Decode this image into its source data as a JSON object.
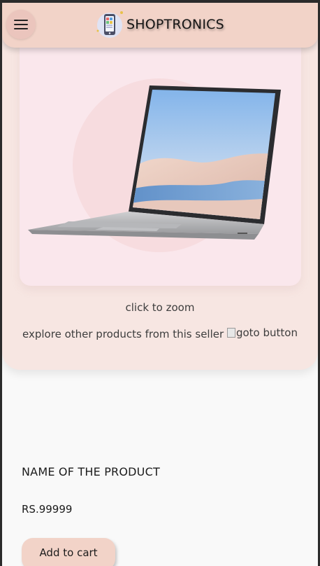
{
  "header": {
    "brand_name": "SHOPTRONICS",
    "menu_icon": "hamburger-menu-icon",
    "logo_icon": "phone-store-logo"
  },
  "product_card": {
    "zoom_text": "click to zoom",
    "explore_text": "explore other products from this seller",
    "goto_alt": "goto button"
  },
  "product": {
    "name": "NAME OF THE PRODUCT",
    "price": "RS.99999",
    "add_to_cart_label": "Add to cart"
  },
  "colors": {
    "header_bg": "#f2d3c8",
    "card_bg": "#f7e6e2",
    "image_bg": "#fae7ec",
    "page_bg": "#f9f9f9",
    "text": "#1c1c1c"
  }
}
